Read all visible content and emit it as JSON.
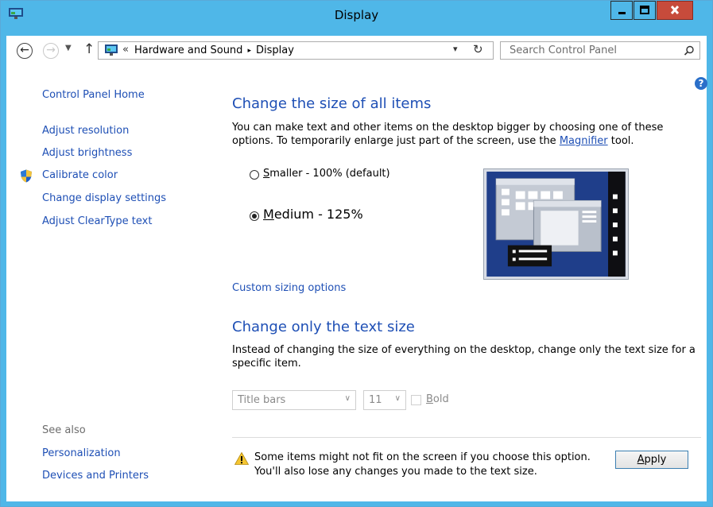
{
  "window": {
    "title": "Display",
    "app_icon": "display-icon",
    "controls": [
      "minimize-icon",
      "maximize-icon",
      "close-icon"
    ]
  },
  "navbar": {
    "back_icon": "back-arrow-icon",
    "forward_icon": "forward-arrow-icon",
    "recent_icon": "chevron-down-icon",
    "up_icon": "up-arrow-icon",
    "address": {
      "overflow": "«",
      "crumbs": [
        "Hardware and Sound",
        "Display"
      ],
      "separator": "▸"
    },
    "refresh_icon": "refresh-icon",
    "search_placeholder": "Search Control Panel",
    "search_icon": "search-icon"
  },
  "sidebar": {
    "home": "Control Panel Home",
    "links": [
      "Adjust resolution",
      "Adjust brightness",
      "Calibrate color",
      "Change display settings",
      "Adjust ClearType text"
    ],
    "see_also_label": "See also",
    "see_also_links": [
      "Personalization",
      "Devices and Printers"
    ]
  },
  "main": {
    "section1_title": "Change the size of all items",
    "section1_desc_a": "You can make text and other items on the desktop bigger by choosing one of these options. To temporarily enlarge just part of the screen, use the ",
    "section1_desc_link": "Magnifier",
    "section1_desc_b": " tool.",
    "options": [
      {
        "accel": "S",
        "rest": "maller - 100% (default)",
        "checked": false
      },
      {
        "accel": "M",
        "rest": "edium - 125%",
        "checked": true
      }
    ],
    "custom_link": "Custom sizing options",
    "section2_title": "Change only the text size",
    "section2_desc": "Instead of changing the size of everything on the desktop, change only the text size for a specific item.",
    "item_select": "Title bars",
    "size_select": "11",
    "bold_accel": "B",
    "bold_rest": "old",
    "warning_line1": "Some items might not fit on the screen if you choose this option.",
    "warning_line2": "You'll also lose any changes you made to the text size.",
    "apply_accel": "A",
    "apply_rest": "pply"
  },
  "colors": {
    "titlebar": "#4fb7e8",
    "link": "#1e4fb5",
    "close_button": "#c74b3b"
  }
}
